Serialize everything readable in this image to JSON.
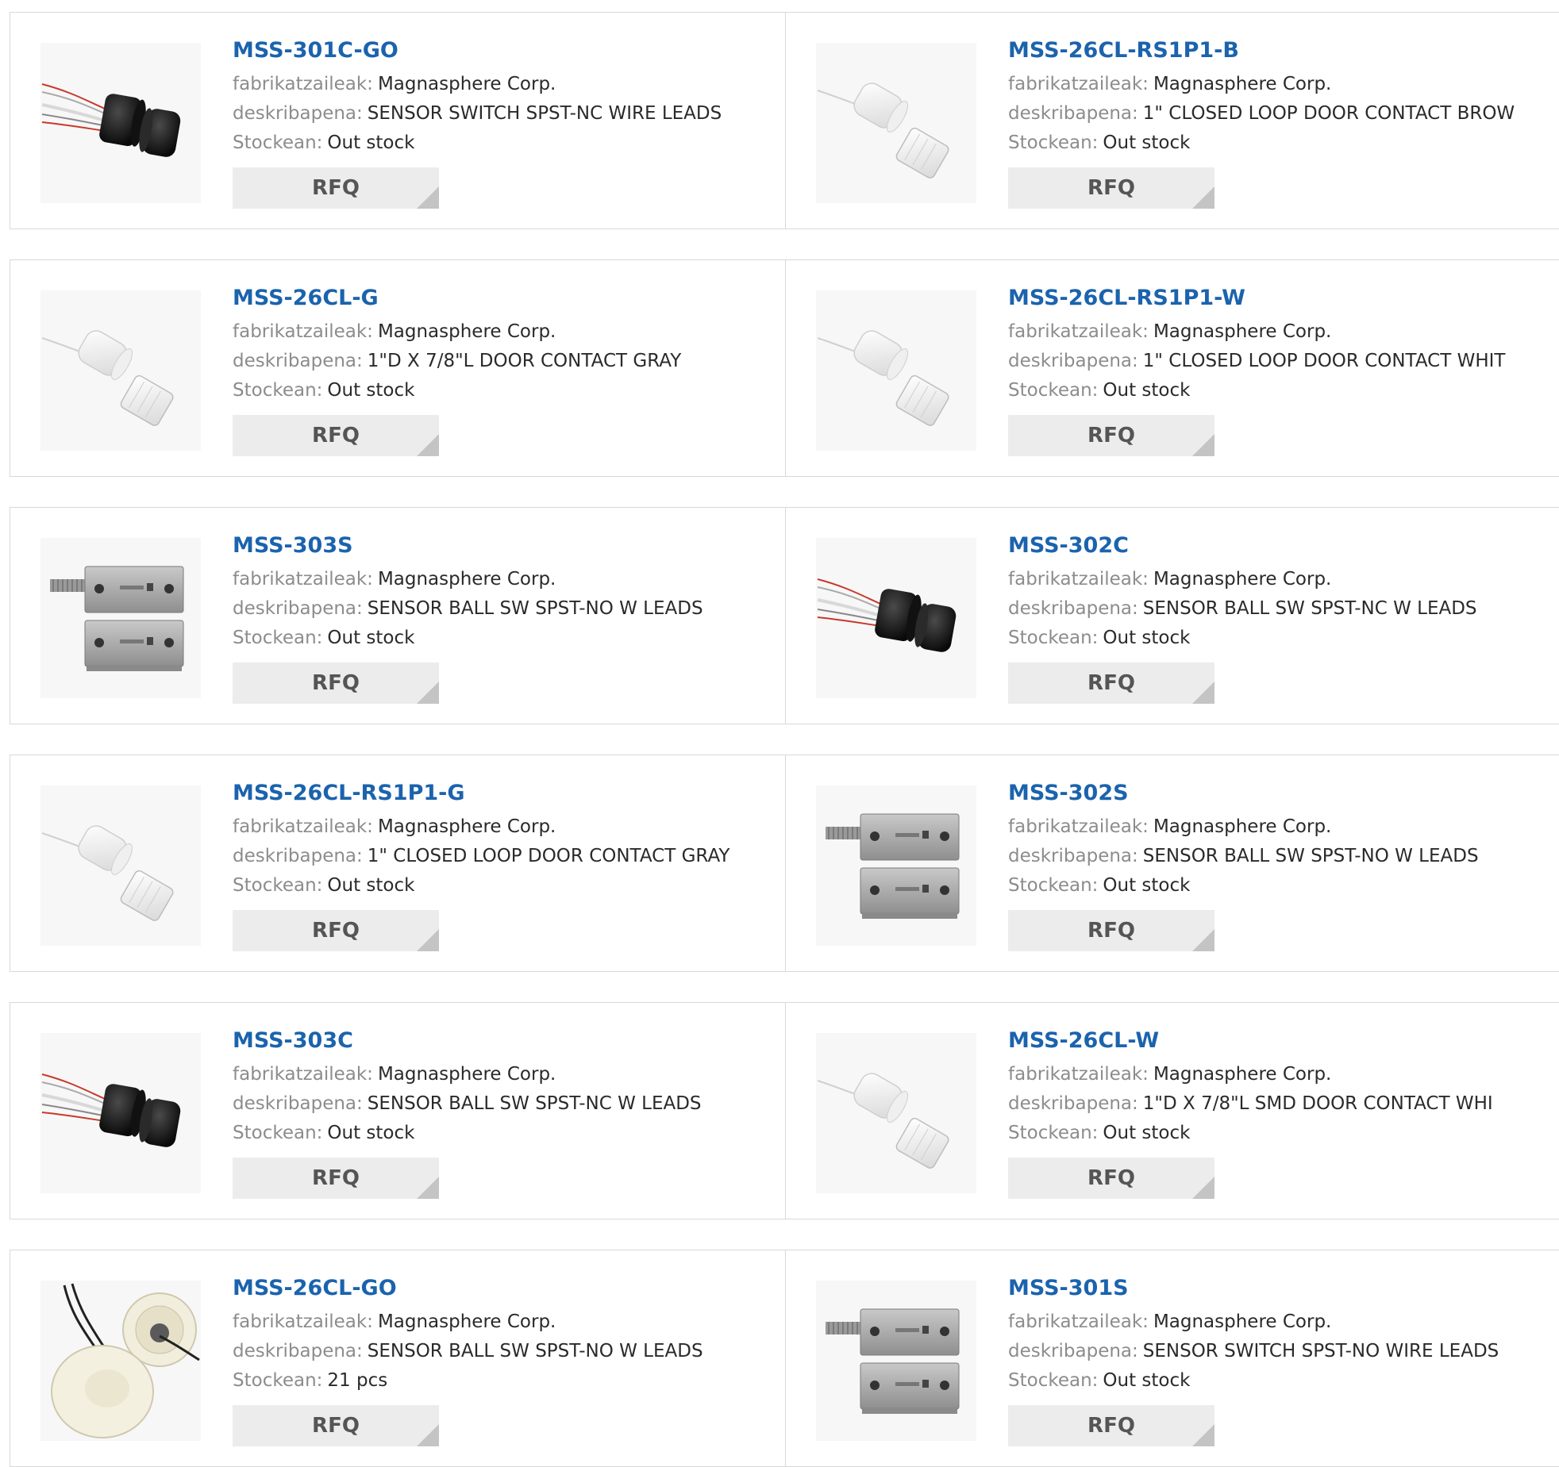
{
  "labels": {
    "manufacturer": "fabrikatzaileak:",
    "description": "deskribapena:",
    "stock": "Stockean:",
    "rfq": "RFQ"
  },
  "products": [
    {
      "part": "MSS-301C-GO",
      "manufacturer": "Magnasphere Corp.",
      "description": "SENSOR SWITCH SPST-NC WIRE LEADS",
      "stock": "Out stock",
      "image": "black-round-sensor-icon"
    },
    {
      "part": "MSS-26CL-RS1P1-B",
      "manufacturer": "Magnasphere Corp.",
      "description": "1\" CLOSED LOOP DOOR CONTACT BROW",
      "stock": "Out stock",
      "image": "white-door-contact-icon"
    },
    {
      "part": "MSS-26CL-G",
      "manufacturer": "Magnasphere Corp.",
      "description": "1\"D X 7/8\"L DOOR CONTACT GRAY",
      "stock": "Out stock",
      "image": "white-door-contact-icon"
    },
    {
      "part": "MSS-26CL-RS1P1-W",
      "manufacturer": "Magnasphere Corp.",
      "description": "1\" CLOSED LOOP DOOR CONTACT WHIT",
      "stock": "Out stock",
      "image": "white-door-contact-icon"
    },
    {
      "part": "MSS-303S",
      "manufacturer": "Magnasphere Corp.",
      "description": "SENSOR BALL SW SPST-NO W LEADS",
      "stock": "Out stock",
      "image": "metal-block-sensor-icon"
    },
    {
      "part": "MSS-302C",
      "manufacturer": "Magnasphere Corp.",
      "description": "SENSOR BALL SW SPST-NC W LEADS",
      "stock": "Out stock",
      "image": "black-round-sensor-icon"
    },
    {
      "part": "MSS-26CL-RS1P1-G",
      "manufacturer": "Magnasphere Corp.",
      "description": "1\" CLOSED LOOP DOOR CONTACT GRAY",
      "stock": "Out stock",
      "image": "white-door-contact-icon"
    },
    {
      "part": "MSS-302S",
      "manufacturer": "Magnasphere Corp.",
      "description": "SENSOR BALL SW SPST-NO W LEADS",
      "stock": "Out stock",
      "image": "metal-block-sensor-icon"
    },
    {
      "part": "MSS-303C",
      "manufacturer": "Magnasphere Corp.",
      "description": "SENSOR BALL SW SPST-NC W LEADS",
      "stock": "Out stock",
      "image": "black-round-sensor-icon"
    },
    {
      "part": "MSS-26CL-W",
      "manufacturer": "Magnasphere Corp.",
      "description": "1\"D X 7/8\"L SMD DOOR CONTACT WHI",
      "stock": "Out stock",
      "image": "white-door-contact-icon"
    },
    {
      "part": "MSS-26CL-GO",
      "manufacturer": "Magnasphere Corp.",
      "description": "SENSOR BALL SW SPST-NO W LEADS",
      "stock": "21 pcs",
      "image": "cream-recessed-contact-icon"
    },
    {
      "part": "MSS-301S",
      "manufacturer": "Magnasphere Corp.",
      "description": "SENSOR SWITCH SPST-NO WIRE LEADS",
      "stock": "Out stock",
      "image": "metal-block-sensor-icon"
    }
  ],
  "colors": {
    "title": "#1b63ad",
    "label": "#8c8c8c",
    "value": "#2a2a2a",
    "rfq_bg": "#ececec",
    "border": "#d8d8d8"
  }
}
